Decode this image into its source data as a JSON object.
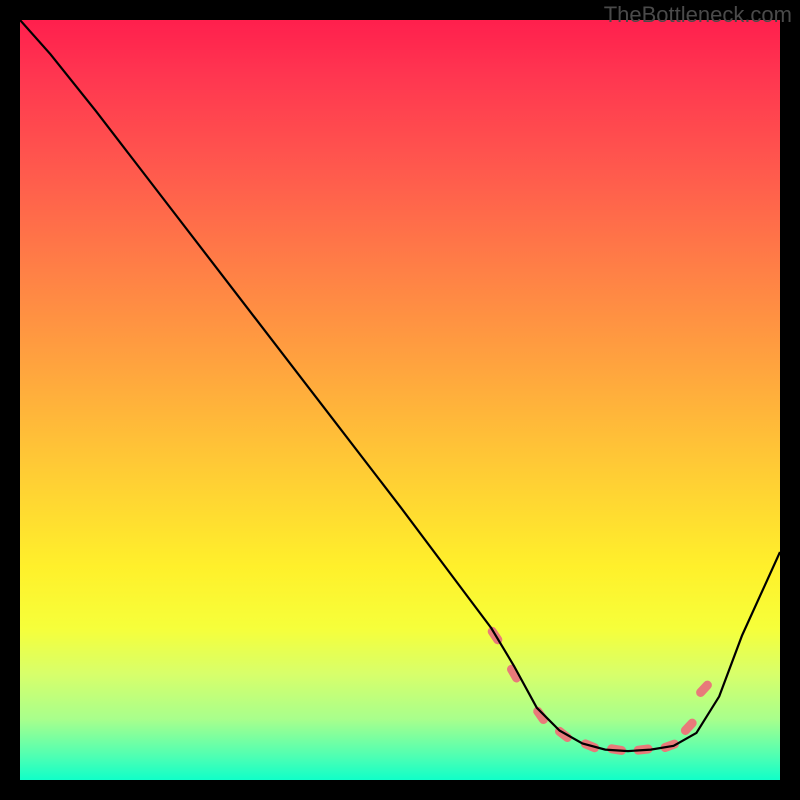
{
  "attribution": "TheBottleneck.com",
  "chart_data": {
    "type": "line",
    "title": "",
    "xlabel": "",
    "ylabel": "",
    "xlim": [
      0,
      100
    ],
    "ylim": [
      0,
      100
    ],
    "series": [
      {
        "name": "curve",
        "x": [
          0,
          4,
          10,
          20,
          30,
          40,
          50,
          59,
          62,
          65,
          68,
          71,
          74,
          77,
          80,
          83,
          86,
          89,
          92,
          95,
          100
        ],
        "y": [
          100,
          95.5,
          88,
          75,
          62,
          49,
          36,
          24,
          20,
          15,
          9.5,
          6.5,
          4.8,
          4,
          3.8,
          4,
          4.5,
          6.2,
          11,
          19,
          30
        ]
      }
    ],
    "markers": {
      "name": "highlight",
      "color": "#e87a7a",
      "x": [
        62.5,
        65,
        68.5,
        71.5,
        75,
        78.5,
        82,
        85.5,
        88,
        90
      ],
      "y": [
        19,
        14,
        8.5,
        6,
        4.5,
        4,
        4,
        4.5,
        7,
        12
      ]
    },
    "gradient_stops": [
      {
        "pos": 0,
        "color": "#ff1f4d"
      },
      {
        "pos": 50,
        "color": "#ffb838"
      },
      {
        "pos": 80,
        "color": "#f6ff3a"
      },
      {
        "pos": 100,
        "color": "#10ffc8"
      }
    ]
  }
}
